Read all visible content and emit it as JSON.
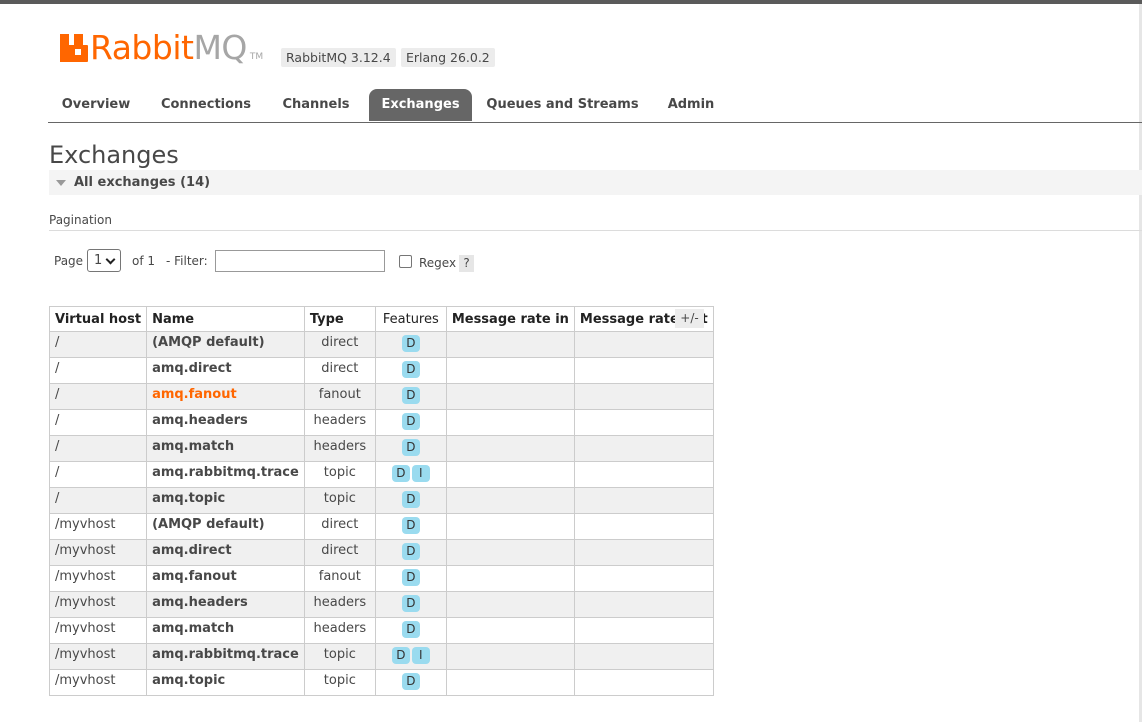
{
  "header": {
    "logo_rabbit": "Rabbit",
    "logo_mq": "MQ",
    "logo_tm": "TM",
    "rabbitmq_version": "RabbitMQ 3.12.4",
    "erlang_version": "Erlang 26.0.2",
    "brand_color": "#ff6600"
  },
  "tabs": [
    {
      "label": "Overview"
    },
    {
      "label": "Connections"
    },
    {
      "label": "Channels"
    },
    {
      "label": "Exchanges"
    },
    {
      "label": "Queues and Streams"
    },
    {
      "label": "Admin"
    }
  ],
  "page": {
    "title": "Exchanges",
    "section_title": "All exchanges (14)",
    "pagination_label": "Pagination"
  },
  "pagination": {
    "page_label": "Page",
    "page_value": "1",
    "of_label": "of 1",
    "filter_label": "- Filter:",
    "filter_value": "",
    "regex_label": "Regex",
    "help_label": "?"
  },
  "table": {
    "columns": [
      "Virtual host",
      "Name",
      "Type",
      "Features",
      "Message rate in",
      "Message rate out"
    ],
    "toggle_label": "+/-",
    "rows": [
      {
        "vhost": "/",
        "name": "(AMQP default)",
        "type": "direct",
        "features": [
          "D"
        ]
      },
      {
        "vhost": "/",
        "name": "amq.direct",
        "type": "direct",
        "features": [
          "D"
        ]
      },
      {
        "vhost": "/",
        "name": "amq.fanout",
        "type": "fanout",
        "features": [
          "D"
        ]
      },
      {
        "vhost": "/",
        "name": "amq.headers",
        "type": "headers",
        "features": [
          "D"
        ]
      },
      {
        "vhost": "/",
        "name": "amq.match",
        "type": "headers",
        "features": [
          "D"
        ]
      },
      {
        "vhost": "/",
        "name": "amq.rabbitmq.trace",
        "type": "topic",
        "features": [
          "D",
          "I"
        ]
      },
      {
        "vhost": "/",
        "name": "amq.topic",
        "type": "topic",
        "features": [
          "D"
        ]
      },
      {
        "vhost": "/myvhost",
        "name": "(AMQP default)",
        "type": "direct",
        "features": [
          "D"
        ]
      },
      {
        "vhost": "/myvhost",
        "name": "amq.direct",
        "type": "direct",
        "features": [
          "D"
        ]
      },
      {
        "vhost": "/myvhost",
        "name": "amq.fanout",
        "type": "fanout",
        "features": [
          "D"
        ]
      },
      {
        "vhost": "/myvhost",
        "name": "amq.headers",
        "type": "headers",
        "features": [
          "D"
        ]
      },
      {
        "vhost": "/myvhost",
        "name": "amq.match",
        "type": "headers",
        "features": [
          "D"
        ]
      },
      {
        "vhost": "/myvhost",
        "name": "amq.rabbitmq.trace",
        "type": "topic",
        "features": [
          "D",
          "I"
        ]
      },
      {
        "vhost": "/myvhost",
        "name": "amq.topic",
        "type": "topic",
        "features": [
          "D"
        ]
      }
    ]
  }
}
